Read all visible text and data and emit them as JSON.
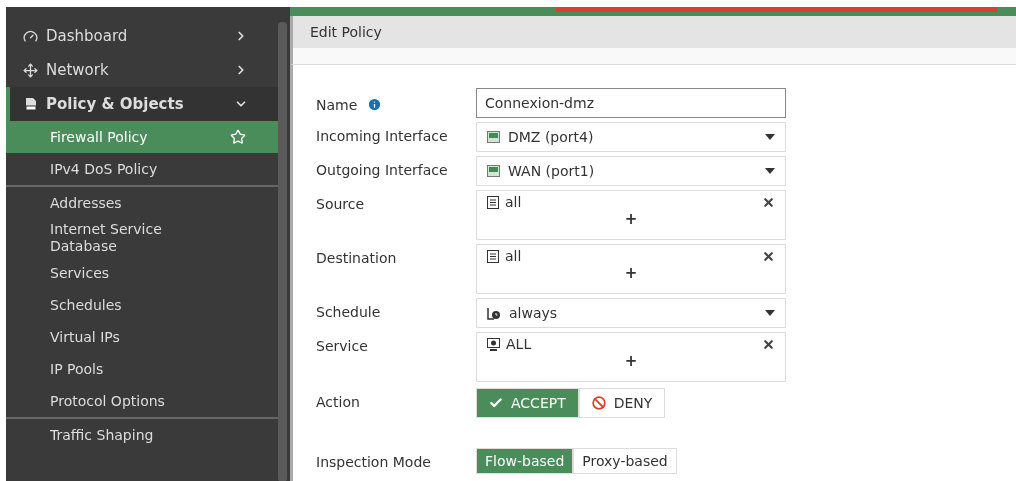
{
  "sidebar": {
    "items": [
      {
        "label": "Dashboard",
        "expanded": false,
        "selected": false
      },
      {
        "label": "Network",
        "expanded": false,
        "selected": false
      },
      {
        "label": "Policy & Objects",
        "expanded": true,
        "selected": true,
        "groups": [
          {
            "children": [
              {
                "label": "Firewall Policy",
                "selected": true
              },
              {
                "label": "IPv4 DoS Policy",
                "selected": false
              }
            ]
          },
          {
            "children": [
              {
                "label": "Addresses",
                "selected": false
              },
              {
                "label": "Internet Service Database",
                "selected": false
              },
              {
                "label": "Services",
                "selected": false
              },
              {
                "label": "Schedules",
                "selected": false
              },
              {
                "label": "Virtual IPs",
                "selected": false
              },
              {
                "label": "IP Pools",
                "selected": false
              },
              {
                "label": "Protocol Options",
                "selected": false
              }
            ]
          },
          {
            "children": [
              {
                "label": "Traffic Shaping",
                "selected": false
              }
            ]
          }
        ]
      }
    ]
  },
  "page": {
    "title": "Edit Policy"
  },
  "form": {
    "fields": [
      {
        "kind": "text",
        "label": "Name",
        "value": "Connexion-dmz"
      },
      {
        "kind": "interface",
        "label": "Incoming Interface",
        "value": "DMZ (port4)"
      },
      {
        "kind": "interface",
        "label": "Outgoing Interface",
        "value": "WAN (port1)"
      },
      {
        "kind": "address",
        "label": "Source",
        "items": [
          "all"
        ],
        "add": "+"
      },
      {
        "kind": "address",
        "label": "Destination",
        "items": [
          "all"
        ],
        "add": "+"
      },
      {
        "kind": "schedule",
        "label": "Schedule",
        "value": "always"
      },
      {
        "kind": "service",
        "label": "Service",
        "items": [
          "ALL"
        ],
        "add": "+"
      },
      {
        "kind": "action",
        "label": "Action",
        "options": [
          {
            "label": "ACCEPT",
            "selected": true
          },
          {
            "label": "DENY",
            "selected": false
          }
        ]
      },
      {
        "kind": "mode",
        "label": "Inspection Mode",
        "options": [
          {
            "label": "Flow-based",
            "selected": true
          },
          {
            "label": "Proxy-based",
            "selected": false
          }
        ]
      }
    ]
  }
}
